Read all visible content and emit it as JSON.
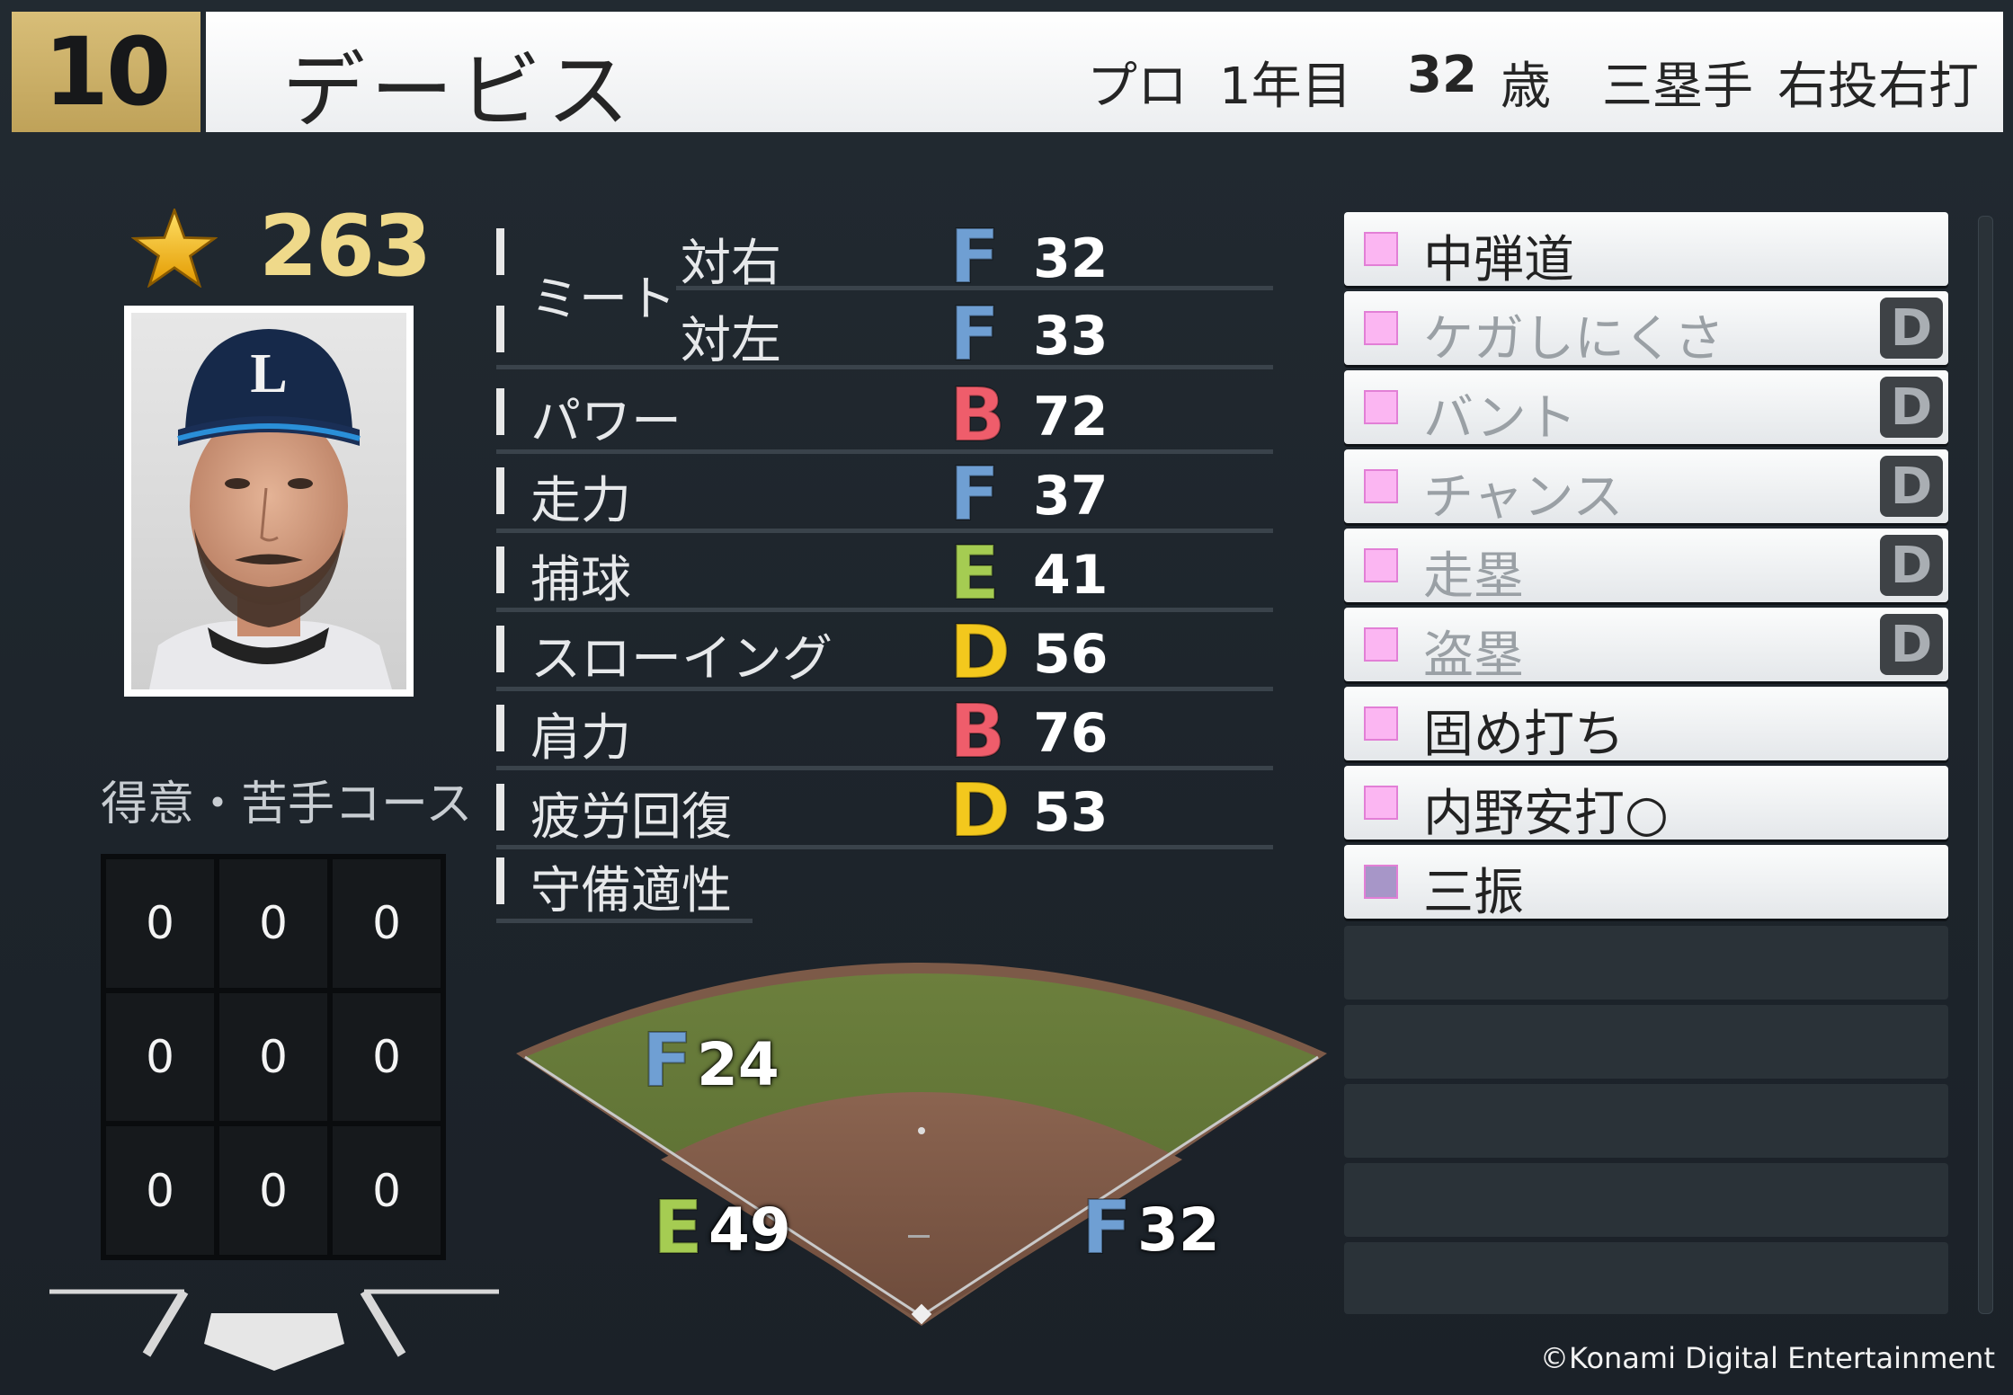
{
  "header": {
    "uniform_number": "10",
    "player_name": "デービス",
    "career_label": "プロ",
    "career_year": "1年目",
    "age": "32",
    "age_unit": "歳",
    "position": "三塁手",
    "throws_bats": "右投右打"
  },
  "overall": {
    "value": "263",
    "icon": "star-icon"
  },
  "course": {
    "title": "得意・苦手コース",
    "cells": [
      "0",
      "0",
      "0",
      "0",
      "0",
      "0",
      "0",
      "0",
      "0"
    ]
  },
  "stats": {
    "meet_label": "ミート",
    "meet_right_label": "対右",
    "meet_right_grade": "F",
    "meet_right_value": "32",
    "meet_left_label": "対左",
    "meet_left_grade": "F",
    "meet_left_value": "33",
    "rows": [
      {
        "label": "パワー",
        "grade": "B",
        "value": "72"
      },
      {
        "label": "走力",
        "grade": "F",
        "value": "37"
      },
      {
        "label": "捕球",
        "grade": "E",
        "value": "41"
      },
      {
        "label": "スローイング",
        "grade": "D",
        "value": "56"
      },
      {
        "label": "肩力",
        "grade": "B",
        "value": "76"
      },
      {
        "label": "疲労回復",
        "grade": "D",
        "value": "53"
      }
    ],
    "defense_label": "守備適性"
  },
  "defense": {
    "left": {
      "grade": "E",
      "value": "49"
    },
    "center": {
      "grade": "F",
      "value": "24"
    },
    "right": {
      "grade": "F",
      "value": "32"
    }
  },
  "grade_colors": {
    "B": "#ef5d6b",
    "D": "#f3c81d",
    "E": "#a5cc52",
    "F": "#6f9fd3"
  },
  "abilities": [
    {
      "label": "中弾道",
      "rank": "",
      "color": "#fbb6f2",
      "dim": false
    },
    {
      "label": "ケガしにくさ",
      "rank": "D",
      "color": "#fbb6f2",
      "dim": true
    },
    {
      "label": "バント",
      "rank": "D",
      "color": "#fbb6f2",
      "dim": true
    },
    {
      "label": "チャンス",
      "rank": "D",
      "color": "#fbb6f2",
      "dim": true
    },
    {
      "label": "走塁",
      "rank": "D",
      "color": "#fbb6f2",
      "dim": true
    },
    {
      "label": "盗塁",
      "rank": "D",
      "color": "#fbb6f2",
      "dim": true
    },
    {
      "label": "固め打ち",
      "rank": "",
      "color": "#fbb6f2",
      "dim": false
    },
    {
      "label": "内野安打○",
      "rank": "",
      "color": "#fbb6f2",
      "dim": false
    },
    {
      "label": "三振",
      "rank": "",
      "color": "#a796c8",
      "dim": false
    }
  ],
  "copyright": "©Konami Digital Entertainment"
}
